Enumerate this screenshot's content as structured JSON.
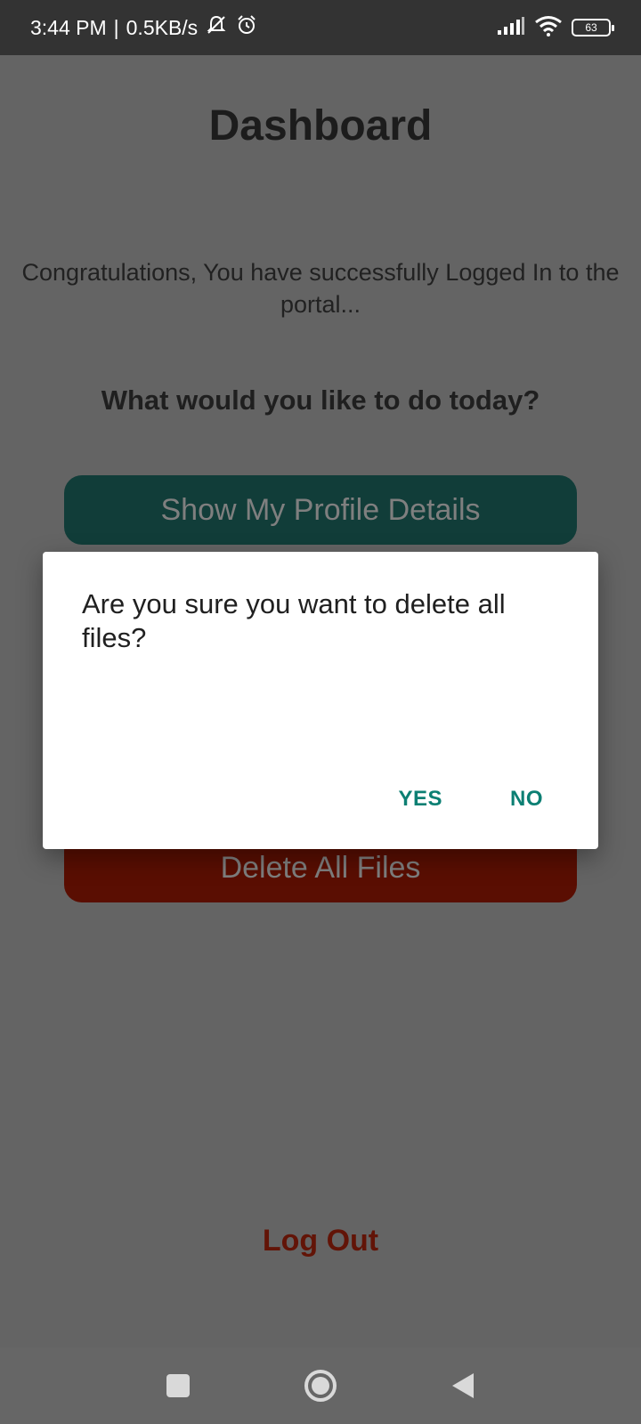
{
  "status_bar": {
    "time": "3:44 PM",
    "separator": "|",
    "network_speed": "0.5KB/s",
    "battery_level": "63",
    "icons": [
      "bell-off-icon",
      "alarm-icon",
      "signal-icon",
      "wifi-icon",
      "battery-icon"
    ]
  },
  "app": {
    "title": "Dashboard",
    "congrats_message": "Congratulations, You have successfully Logged In to the portal...",
    "question": "What would you like to do today?",
    "show_profile_label": "Show My Profile Details",
    "delete_all_label": "Delete All Files",
    "logout_label": "Log Out"
  },
  "dialog": {
    "message": "Are you sure you want to delete all files?",
    "yes_label": "YES",
    "no_label": "NO"
  },
  "nav_bar": {
    "icons": [
      "recents-icon",
      "home-icon",
      "back-icon"
    ]
  },
  "colors": {
    "accent_teal": "#0c7f73",
    "profile_button": "#113d39",
    "delete_button": "#5a0e02",
    "logout_text": "#621407",
    "scrim": "#646464"
  }
}
